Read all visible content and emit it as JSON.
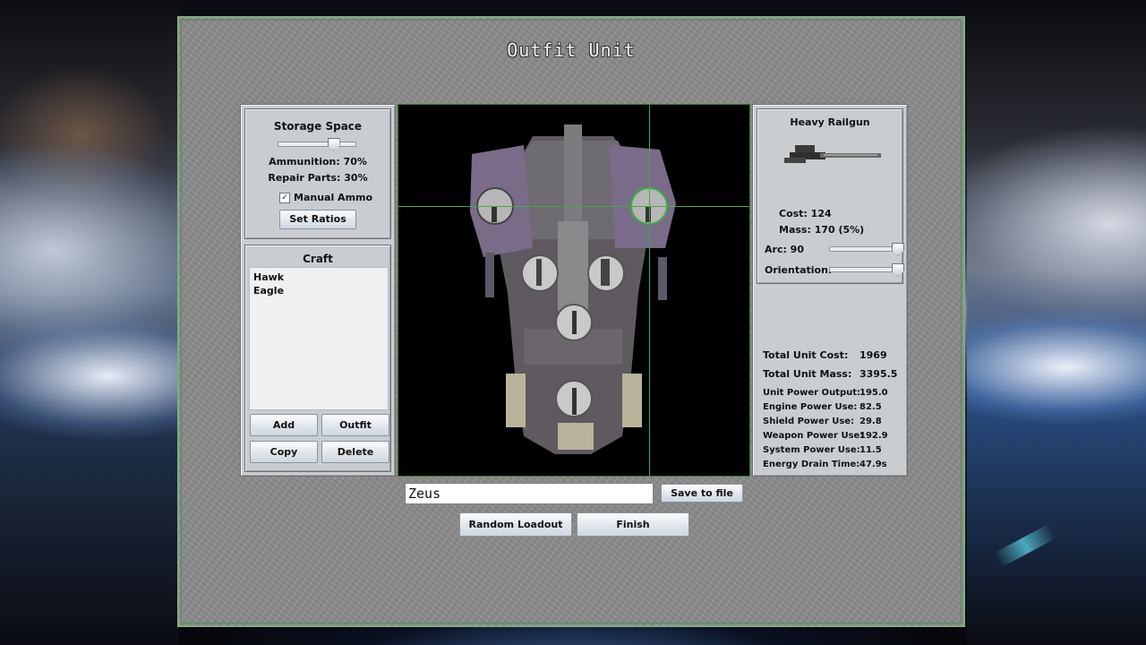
{
  "window": {
    "title": "Outfit Unit"
  },
  "storage": {
    "title": "Storage Space",
    "slider_value": 0.7,
    "ammunition": "Ammunition: 70%",
    "repair_parts": "Repair Parts: 30%",
    "manual_ammo_label": "Manual Ammo",
    "manual_ammo_checked": true,
    "set_ratios": "Set Ratios"
  },
  "craft": {
    "title": "Craft",
    "items": [
      "Hawk",
      "Eagle"
    ],
    "add": "Add",
    "outfit": "Outfit",
    "copy": "Copy",
    "delete": "Delete"
  },
  "weapon": {
    "name": "Heavy Railgun",
    "cost": "Cost: 124",
    "mass": "Mass: 170 (5%)",
    "arc_label": "Arc: 90",
    "arc_value": 1.0,
    "orientation_label": "Orientation:",
    "orientation_value": 1.0
  },
  "totals": {
    "cost_label": "Total Unit Cost:",
    "cost_value": "1969",
    "mass_label": "Total Unit Mass:",
    "mass_value": "3395.5"
  },
  "power": [
    {
      "label": "Unit Power Output:",
      "value": "195.0"
    },
    {
      "label": "Engine Power Use:",
      "value": "82.5"
    },
    {
      "label": "Shield Power Use:",
      "value": "29.8"
    },
    {
      "label": "Weapon Power Use:",
      "value": "192.9"
    },
    {
      "label": "System Power Use:",
      "value": "11.5"
    },
    {
      "label": "Energy Drain Time:",
      "value": "47.9s"
    }
  ],
  "bottom": {
    "unit_name": "Zeus",
    "save_to_file": "Save to file",
    "random_loadout": "Random Loadout",
    "finish": "Finish"
  }
}
